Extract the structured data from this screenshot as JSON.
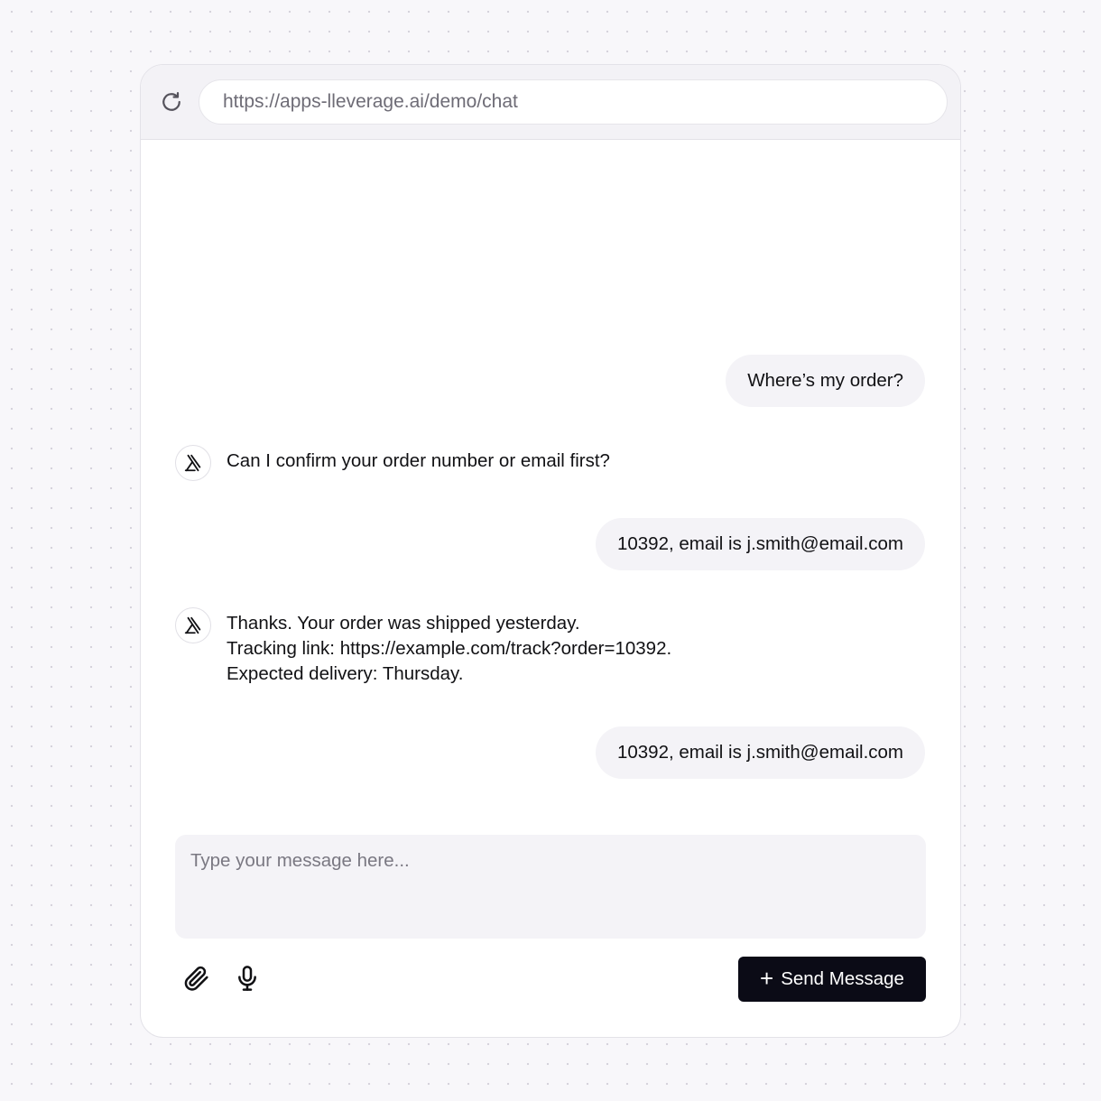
{
  "browser": {
    "url": "https://apps-lleverage.ai/demo/chat",
    "reload_icon": "reload-icon"
  },
  "chat": {
    "messages": [
      {
        "role": "user",
        "text": "Where’s my order?"
      },
      {
        "role": "bot",
        "lines": [
          "Can I confirm your order number or email first?"
        ]
      },
      {
        "role": "user",
        "text": "10392, email is j.smith@email.com"
      },
      {
        "role": "bot",
        "lines": [
          "Thanks. Your order was shipped yesterday.",
          "Tracking link: https://example.com/track?order=10392.",
          "Expected delivery: Thursday."
        ]
      },
      {
        "role": "user",
        "text": "10392, email is j.smith@email.com"
      }
    ],
    "bot_avatar_icon": "lleverage-logo-icon"
  },
  "composer": {
    "placeholder": "Type your message here...",
    "value": "",
    "attach_icon": "paperclip-icon",
    "mic_icon": "microphone-icon",
    "send_label": "Send Message",
    "send_icon": "plus-icon"
  },
  "colors": {
    "page_background": "#f8f7fa",
    "window_background": "#ffffff",
    "bubble_background": "#f4f3f7",
    "button_background": "#0b0b16",
    "text": "#111114",
    "muted_text": "#6e6c76"
  }
}
